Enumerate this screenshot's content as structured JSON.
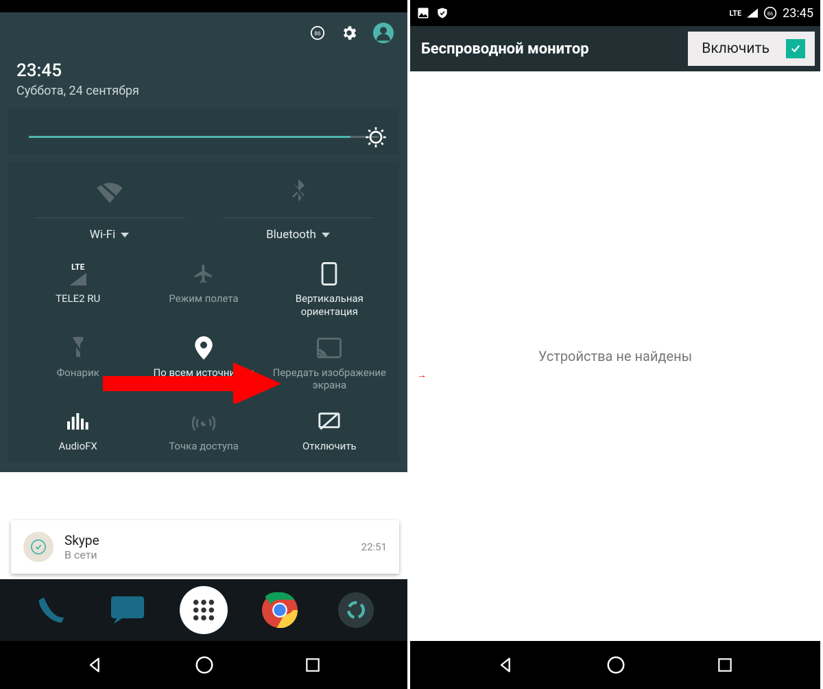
{
  "left": {
    "time": "23:45",
    "date": "Суббота, 24 сентября",
    "battery_badge": "86",
    "big_tiles": [
      {
        "label": "Wi-Fi"
      },
      {
        "label": "Bluetooth"
      }
    ],
    "tiles": [
      {
        "head": "LTE",
        "label": "TELE2 RU"
      },
      {
        "label": "Режим полета"
      },
      {
        "label": "Вертикальная ориентация"
      },
      {
        "label": "Фонарик"
      },
      {
        "label": "По всем источникам"
      },
      {
        "label": "Передать изображение экрана"
      },
      {
        "label": "AudioFX"
      },
      {
        "label": "Точка доступа"
      },
      {
        "label": "Отключить"
      }
    ],
    "notification": {
      "app": "Skype",
      "status": "В сети",
      "time": "22:51"
    }
  },
  "right": {
    "status_time": "23:45",
    "status_lte": "LTE",
    "status_battery": "86",
    "title": "Беспроводной монитор",
    "toggle_label": "Включить",
    "empty_text": "Устройства не найдены"
  }
}
